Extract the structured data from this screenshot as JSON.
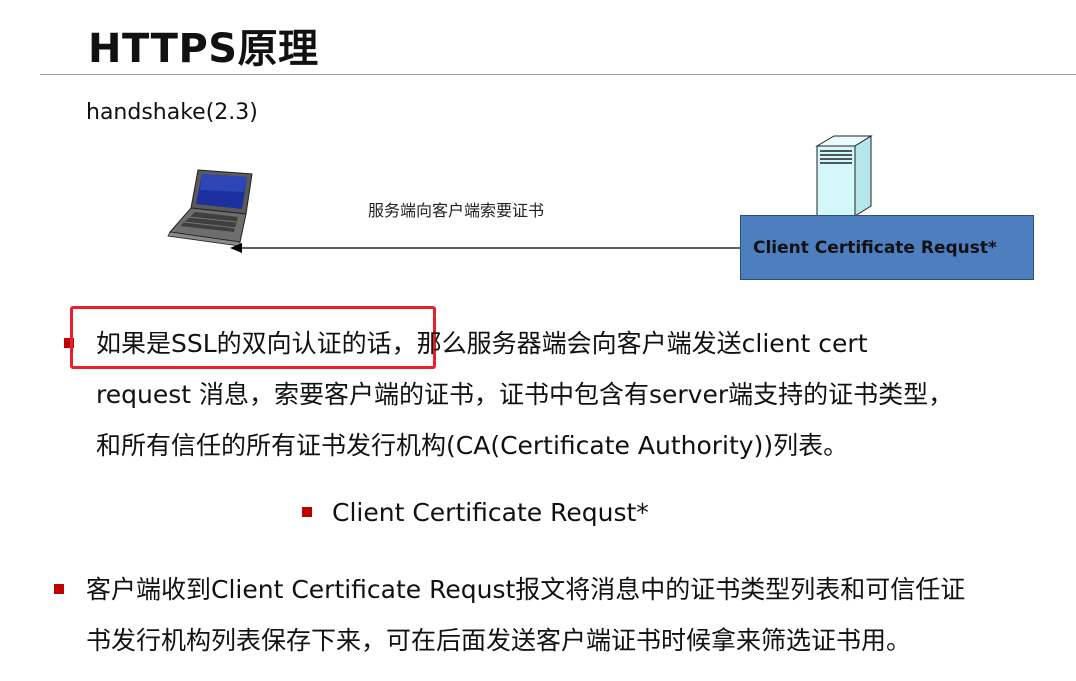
{
  "slide": {
    "title": "HTTPS原理",
    "subtitle": "handshake(2.3)"
  },
  "diagram": {
    "arrow_caption": "服务端向客户端索要证书",
    "message_box_label": "Client Certificate Requst*",
    "message_box_color": "#4d7fc0",
    "left_icon": "laptop-icon",
    "right_icon": "server-icon"
  },
  "bullets": {
    "first": {
      "highlighted": "如果是SSL的双向认证的话",
      "line1_rest": "，那么服务器端会向客户端发送client cert",
      "line2": "request 消息，索要客户端的证书，证书中包含有server端支持的证书类型，",
      "line3": "和所有信任的所有证书发行机构(CA(Certificate Authority))列表。"
    },
    "sub": "Client Certificate Requst*",
    "second": {
      "line1": "客户端收到Client Certificate Requst报文将消息中的证书类型列表和可信任证",
      "line2": "书发行机构列表保存下来，可在后面发送客户端证书时候拿来筛选证书用。"
    }
  },
  "colors": {
    "bullet": "#c00000",
    "highlight_border": "#e8202a"
  }
}
